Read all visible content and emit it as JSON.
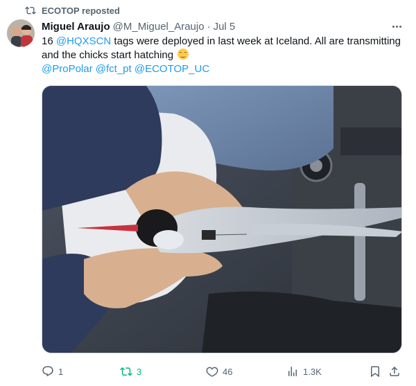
{
  "repost": {
    "label": "ECOTOP reposted",
    "icon": "repost-icon"
  },
  "author": {
    "name": "Miguel Araujo",
    "handle": "@M_Miguel_Araujo",
    "separator": "·",
    "date": "Jul 5"
  },
  "tweet": {
    "count": "16",
    "mention1": "@HQXSCN",
    "text1": " tags were deployed in last week at Iceland. All are transmitting and the chicks start hatching ",
    "emoji": "smiling-face-emoji",
    "mention2": "@ProPolar",
    "mention3": "@fct_pt",
    "mention4": "@ECOTOP_UC"
  },
  "media": {
    "subject": "photo"
  },
  "actions": {
    "replies": "1",
    "reposts": "3",
    "likes": "46",
    "views": "1.3K"
  },
  "colors": {
    "accent": "#1d9bf0",
    "repost_active": "#00ba7c",
    "muted": "#536471",
    "text": "#0f1419"
  }
}
